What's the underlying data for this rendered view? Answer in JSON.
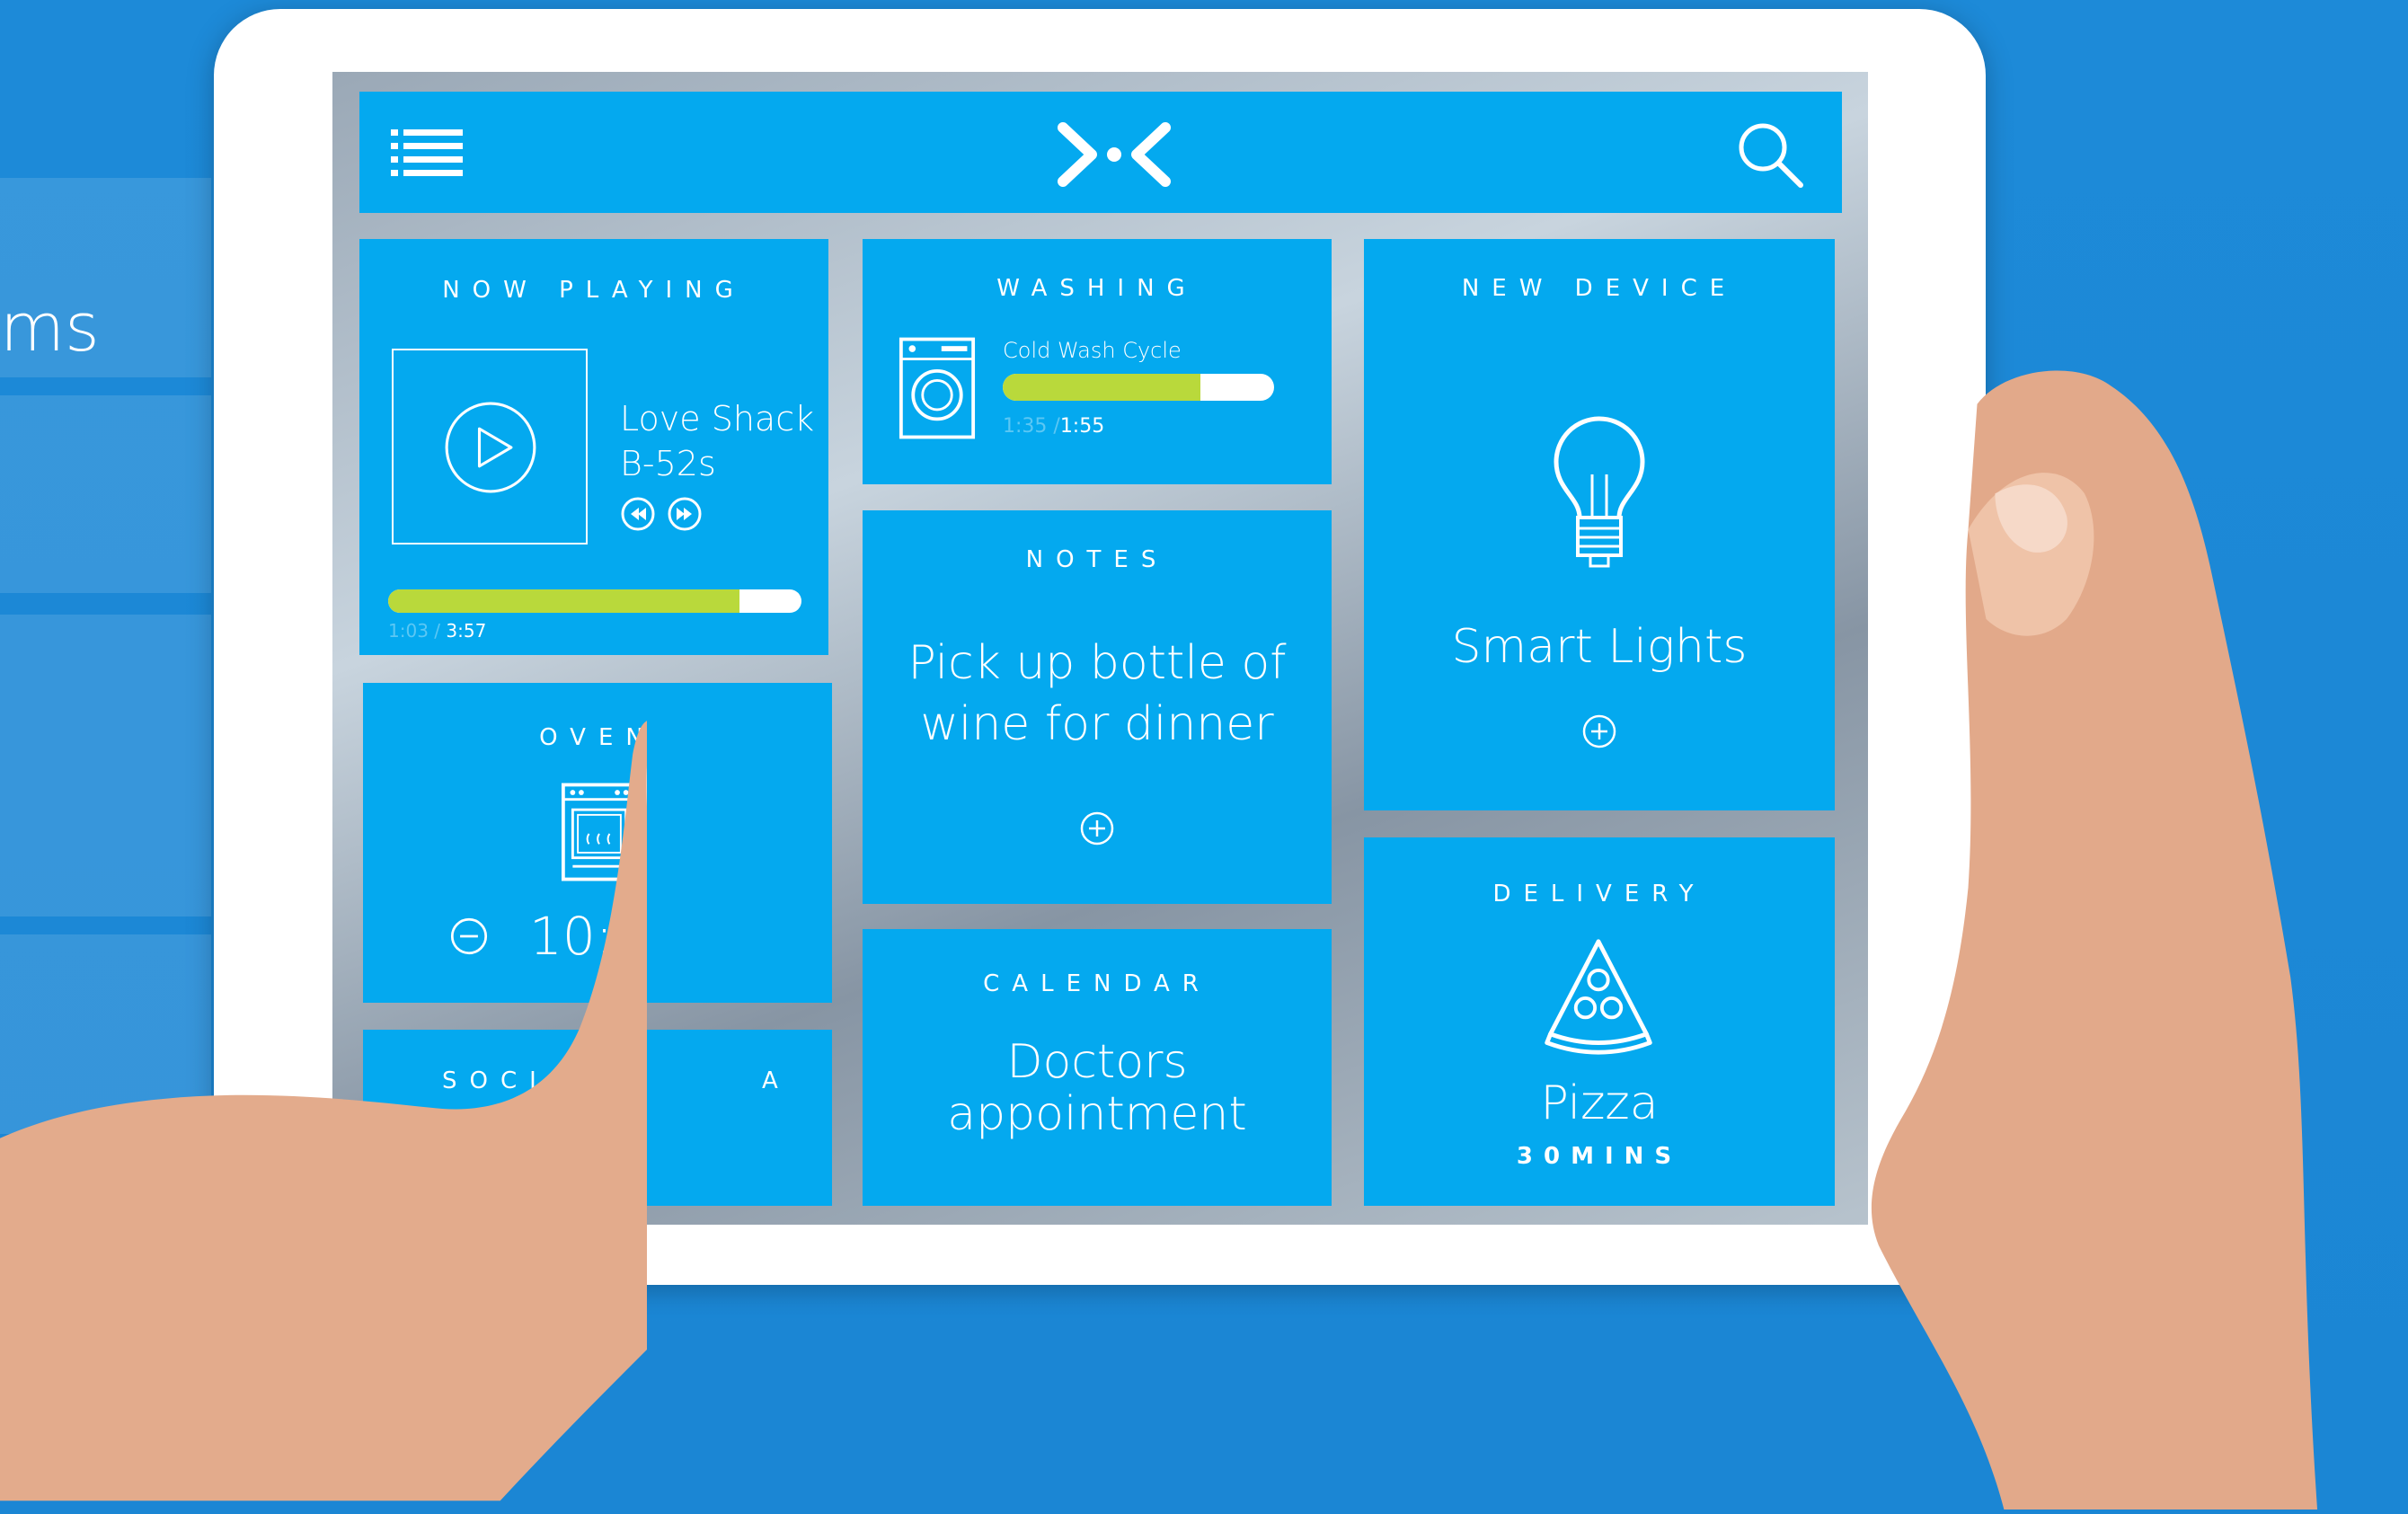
{
  "background": {
    "panel_text": "ms"
  },
  "header": {
    "menu_icon": "list-menu-icon",
    "logo_icon": "brand-logo",
    "search_icon": "search-icon"
  },
  "now_playing": {
    "title": "NOW PLAYING",
    "song": "Love Shack",
    "artist": "B-52s",
    "elapsed": "1:03",
    "separator": " / ",
    "duration": "3:57",
    "progress": 0.85
  },
  "washing": {
    "title": "WASHING",
    "cycle": "Cold Wash Cycle",
    "elapsed": "1:35",
    "separator": " /",
    "duration": "1:55",
    "progress": 0.73
  },
  "new_device": {
    "title": "NEW DEVICE",
    "device": "Smart Lights"
  },
  "notes": {
    "title": "NOTES",
    "line1": "Pick up bottle of",
    "line2": "wine for dinner"
  },
  "oven": {
    "title": "OVEN",
    "time": "10:0"
  },
  "calendar": {
    "title": "CALENDAR",
    "line1": "Doctors",
    "line2": "appointment"
  },
  "delivery": {
    "title": "DELIVERY",
    "item": "Pizza",
    "eta": "30MINS"
  },
  "social": {
    "title_left": "SOCIA",
    "title_right": "A",
    "icon": "facebook-icon"
  },
  "colors": {
    "background": "#1b86d4",
    "tile": "#04a9ef",
    "progress": "#b9d93b"
  }
}
